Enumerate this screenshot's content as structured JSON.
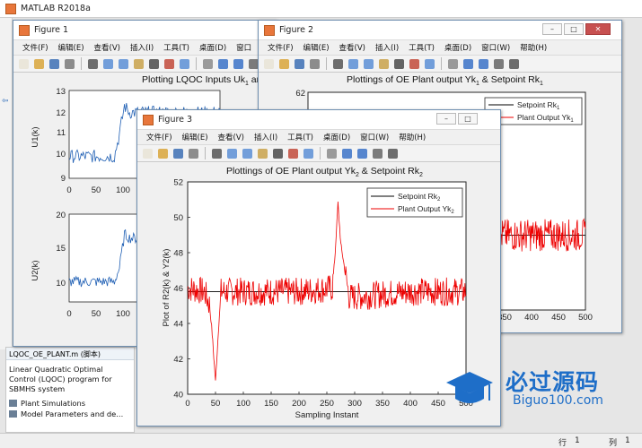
{
  "main_window": {
    "title": "MATLAB R2018a"
  },
  "file_panel": {
    "file_name": "LQOC_OE_PLANT.m",
    "file_tag": "(脚本)",
    "description": [
      "Linear Quadratic Optimal",
      "Control (LQOC) program for",
      "SBMHS system"
    ],
    "items": [
      "Plant Simulations",
      "Model Parameters and de..."
    ]
  },
  "status_bar": {
    "row_label": "行",
    "row_value": "1",
    "col_label": "列",
    "col_value": "1"
  },
  "watermark": {
    "line1": "必过源码",
    "line2": "Biguo100.com"
  },
  "menu": [
    "文件(F)",
    "编辑(E)",
    "查看(V)",
    "插入(I)",
    "工具(T)",
    "桌面(D)",
    "窗口(W)",
    "帮助(H)"
  ],
  "figure1": {
    "title": "Figure 1",
    "menu_visible": [
      "文件(F)",
      "编辑(E)",
      "查看(V)",
      "插入(I)",
      "工具(T)",
      "桌面(D)",
      "窗口"
    ],
    "plot_title": "Plotting LQOC Inputs Uk",
    "plot_title_sub": "1",
    "plot_title_tail": " and",
    "top_ylabel": "U1(k)",
    "bottom_ylabel": "U2(k)",
    "top_yticks": [
      "13",
      "12",
      "11",
      "10",
      "9"
    ],
    "bottom_yticks": [
      "20",
      "15",
      "10"
    ],
    "xticks": [
      "0",
      "50",
      "100"
    ]
  },
  "figure2": {
    "title": "Figure 2",
    "plot_title": "Plottings of OE Plant output Yk",
    "plot_title_sub1": "1",
    "plot_title_mid": " & Setpoint Rk",
    "plot_title_sub2": "1",
    "ytick_top": "62",
    "xticks": [
      "350",
      "400",
      "450",
      "500"
    ],
    "legend": [
      {
        "label": "Setpoint Rk",
        "sub": "1",
        "color": "#000000"
      },
      {
        "label": "Plant Output Yk",
        "sub": "1",
        "color": "#ee0000"
      }
    ]
  },
  "figure3": {
    "title": "Figure 3",
    "menu": [
      "文件(F)",
      "编辑(E)",
      "查看(V)",
      "插入(I)",
      "工具(T)",
      "桌面(D)",
      "窗口(W)",
      "帮助(H)"
    ],
    "plot_title": "Plottings of OE Plant output Yk",
    "plot_title_sub1": "2",
    "plot_title_mid": " & Setpoint Rk",
    "plot_title_sub2": "2",
    "ylabel": "Plot of R2(k) & Y2(k)",
    "xlabel": "Sampling Instant",
    "legend": [
      {
        "label": "Setpoint Rk",
        "sub": "2",
        "color": "#000000"
      },
      {
        "label": "Plant Output Yk",
        "sub": "2",
        "color": "#ee0000"
      }
    ]
  },
  "chart_data": [
    {
      "type": "line",
      "title": "Plottings of OE Plant output Yk2 & Setpoint Rk2",
      "xlabel": "Sampling Instant",
      "ylabel": "Plot of R2(k) & Y2(k)",
      "xlim": [
        0,
        500
      ],
      "ylim": [
        40,
        52
      ],
      "xticks": [
        0,
        50,
        100,
        150,
        200,
        250,
        300,
        350,
        400,
        450,
        500
      ],
      "yticks": [
        40,
        42,
        44,
        46,
        48,
        50,
        52
      ],
      "legend_position": "top-right",
      "series": [
        {
          "name": "Setpoint Rk2",
          "color": "#000000",
          "x": [
            0,
            500
          ],
          "y": [
            45.8,
            45.8
          ]
        },
        {
          "name": "Plant Output Yk2",
          "color": "#ee0000",
          "x": [
            0,
            30,
            40,
            45,
            50,
            55,
            60,
            100,
            200,
            260,
            265,
            270,
            275,
            280,
            290,
            300,
            400,
            500
          ],
          "y": [
            46.0,
            45.8,
            45.0,
            43.0,
            40.7,
            43.5,
            45.8,
            45.8,
            45.8,
            46.0,
            48.0,
            50.8,
            48.5,
            47.5,
            45.5,
            45.5,
            45.8,
            45.8
          ],
          "noise_amplitude": 0.8
        }
      ]
    },
    {
      "type": "line",
      "title": "Plotting LQOC Inputs Uk1",
      "ylabel": "U1(k)",
      "xlim": [
        0,
        150
      ],
      "ylim": [
        9,
        13
      ],
      "xticks": [
        0,
        50,
        100
      ],
      "yticks": [
        9,
        10,
        11,
        12,
        13
      ],
      "series": [
        {
          "x": [
            0,
            45,
            50,
            55,
            60,
            100,
            150
          ],
          "y": [
            10.0,
            10.0,
            11.0,
            12.3,
            12.0,
            12.0,
            12.0
          ],
          "noise_amplitude": 0.3
        }
      ]
    },
    {
      "type": "line",
      "ylabel": "U2(k)",
      "xlim": [
        0,
        150
      ],
      "ylim": [
        7,
        20
      ],
      "xticks": [
        0,
        50,
        100
      ],
      "yticks": [
        10,
        15,
        20
      ],
      "series": [
        {
          "x": [
            0,
            45,
            50,
            55,
            60,
            100,
            150
          ],
          "y": [
            10.0,
            10.0,
            12.0,
            17.0,
            16.5,
            16.0,
            16.0
          ],
          "noise_amplitude": 0.8
        }
      ]
    },
    {
      "type": "line",
      "title": "Plottings of OE Plant output Yk1 & Setpoint Rk1",
      "xlim": [
        300,
        500
      ],
      "ylim": [
        46,
        62
      ],
      "xticks": [
        350,
        400,
        450,
        500
      ],
      "legend_position": "top-right",
      "series": [
        {
          "name": "Setpoint Rk1",
          "color": "#000000",
          "x": [
            300,
            500
          ],
          "y": [
            51.5,
            51.5
          ]
        },
        {
          "name": "Plant Output Yk1",
          "color": "#ee0000",
          "x": [
            300,
            500
          ],
          "y": [
            51.5,
            51.5
          ],
          "noise_amplitude": 1.2
        }
      ]
    }
  ]
}
